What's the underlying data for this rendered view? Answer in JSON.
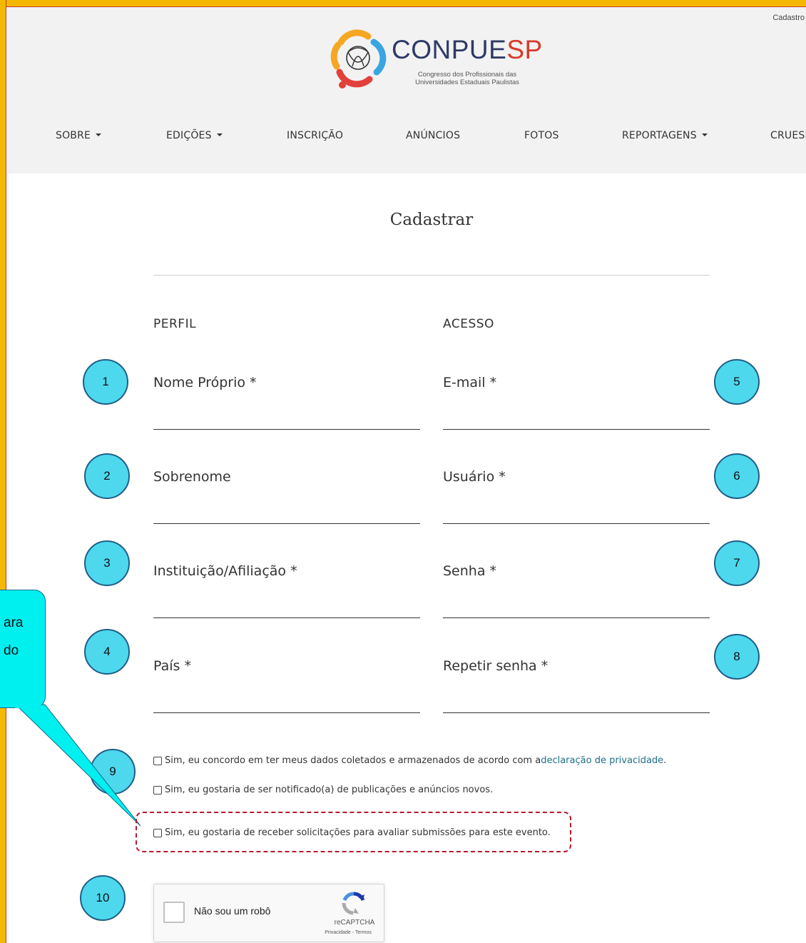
{
  "header": {
    "top_link": "Cadastro",
    "logo_title_main": "CONPUE",
    "logo_title_accent": "SP",
    "logo_subtitle_line1": "Congresso dos Profissionais das",
    "logo_subtitle_line2": "Universidades Estaduais Paulistas"
  },
  "nav": {
    "items": [
      {
        "label": "SOBRE",
        "dropdown": true
      },
      {
        "label": "EDIÇÕES",
        "dropdown": true
      },
      {
        "label": "INSCRIÇÃO",
        "dropdown": false
      },
      {
        "label": "ANÚNCIOS",
        "dropdown": false
      },
      {
        "label": "FOTOS",
        "dropdown": false
      },
      {
        "label": "REPORTAGENS",
        "dropdown": true
      },
      {
        "label": "CRUESP",
        "dropdown": false
      }
    ]
  },
  "page": {
    "title": "Cadastrar"
  },
  "form": {
    "perfil_heading": "PERFIL",
    "acesso_heading": "ACESSO",
    "perfil_fields": [
      {
        "label": "Nome Próprio *",
        "value": ""
      },
      {
        "label": "Sobrenome",
        "value": ""
      },
      {
        "label": "Instituição/Afiliação *",
        "value": ""
      },
      {
        "label": "País *",
        "value": ""
      }
    ],
    "acesso_fields": [
      {
        "label": "E-mail *",
        "value": ""
      },
      {
        "label": "Usuário *",
        "value": ""
      },
      {
        "label": "Senha *",
        "value": ""
      },
      {
        "label": "Repetir senha *",
        "value": ""
      }
    ],
    "consents": {
      "privacy_text": "Sim, eu concordo em ter meus dados coletados e armazenados de acordo com a ",
      "privacy_link": "declaração de privacidade",
      "privacy_end": ".",
      "notify_text": "Sim, eu gostaria de ser notificado(a) de publicações e anúncios novos.",
      "review_text": "Sim, eu gostaria de receber solicitações para avaliar submissões para este evento."
    }
  },
  "recaptcha": {
    "label": "Não sou um robô",
    "brand": "reCAPTCHA",
    "terms": "Privacidade - Termos"
  },
  "annotations": {
    "badges": [
      "1",
      "2",
      "3",
      "4",
      "5",
      "6",
      "7",
      "8",
      "9",
      "10"
    ],
    "callout_lines": [
      "ara",
      "do"
    ]
  },
  "colors": {
    "frame": "#f5b800",
    "badge_fill": "#4dd8ee",
    "callout_fill": "#00f0f0",
    "highlight_border": "#b3192b",
    "link": "#1e6f8a",
    "logo_accent": "#d93a2b"
  }
}
